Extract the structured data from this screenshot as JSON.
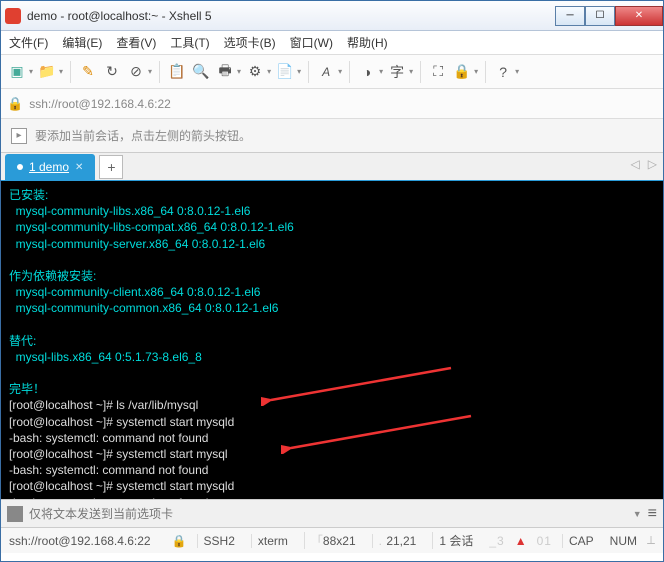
{
  "window": {
    "title": "demo - root@localhost:~ - Xshell 5"
  },
  "menu": {
    "file": "文件(F)",
    "edit": "编辑(E)",
    "view": "查看(V)",
    "tools": "工具(T)",
    "tabs": "选项卡(B)",
    "window": "窗口(W)",
    "help": "帮助(H)"
  },
  "address": "ssh://root@192.168.4.6:22",
  "hint": "要添加当前会话，点击左侧的箭头按钮。",
  "tab": {
    "label": "1 demo"
  },
  "send_placeholder": "仅将文本发送到当前选项卡",
  "term": {
    "installed_hdr": "已安装:",
    "pkg1": "  mysql-community-libs.x86_64 0:8.0.12-1.el6",
    "pkg2": "  mysql-community-libs-compat.x86_64 0:8.0.12-1.el6",
    "pkg3": "  mysql-community-server.x86_64 0:8.0.12-1.el6",
    "dep_hdr": "作为依赖被安装:",
    "dep1": "  mysql-community-client.x86_64 0:8.0.12-1.el6",
    "dep2": "  mysql-community-common.x86_64 0:8.0.12-1.el6",
    "rep_hdr": "替代:",
    "rep1": "  mysql-libs.x86_64 0:5.1.73-8.el6_8",
    "done": "完毕！",
    "p1a": "[root@localhost ~]# ",
    "c1": "ls /var/lib/mysql",
    "p2a": "[root@localhost ~]# ",
    "c2": "systemctl start mysqld",
    "e1": "-bash: systemctl: command not found",
    "p3a": "[root@localhost ~]# ",
    "c3": "systemctl start mysql",
    "e2": "-bash: systemctl: command not found",
    "p4a": "[root@localhost ~]# ",
    "c4": "systemctl start mysqld",
    "e3": "-bash: systemctl: command not found"
  },
  "status": {
    "conn": "ssh://root@192.168.4.6:22",
    "proto": "SSH2",
    "termtype": "xterm",
    "size": "88x21",
    "pos": "21,21",
    "sessions": "1 会话",
    "watermark": "_3",
    "wm2": "01",
    "cap": "CAP",
    "num": "NUM"
  }
}
